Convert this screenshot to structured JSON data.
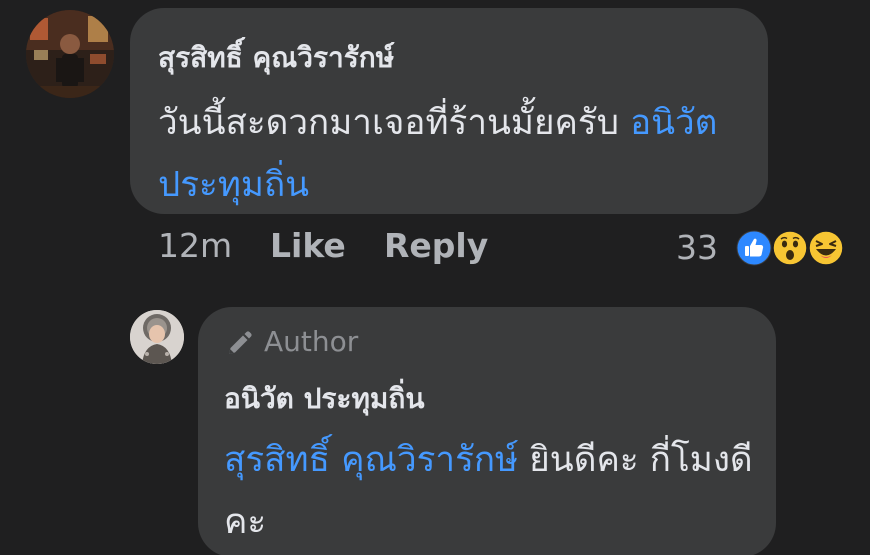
{
  "comment": {
    "author_name": "สุรสิทธิ์ คุณวิรารักษ์",
    "text": "วันนี้สะดวกมาเจอที่ร้านมั้ยครับ",
    "mention": "อนิวัต ประทุมถิ่น",
    "time": "12m",
    "like_label": "Like",
    "reply_label": "Reply",
    "reaction_count": "33",
    "reactions": [
      "like-icon",
      "wow-icon",
      "haha-icon"
    ],
    "colors": {
      "bubble": "#3a3b3c",
      "mention": "#4599ff",
      "muted": "#b0b3b8",
      "background": "#1f1f20"
    }
  },
  "reply": {
    "badge_label": "Author",
    "badge_icon": "pencil-icon",
    "author_name": "อนิวัต ประทุมถิ่น",
    "mention": "สุรสิทธิ์ คุณวิรารักษ์",
    "text": "ยินดีคะ กี่โมงดีคะ"
  }
}
